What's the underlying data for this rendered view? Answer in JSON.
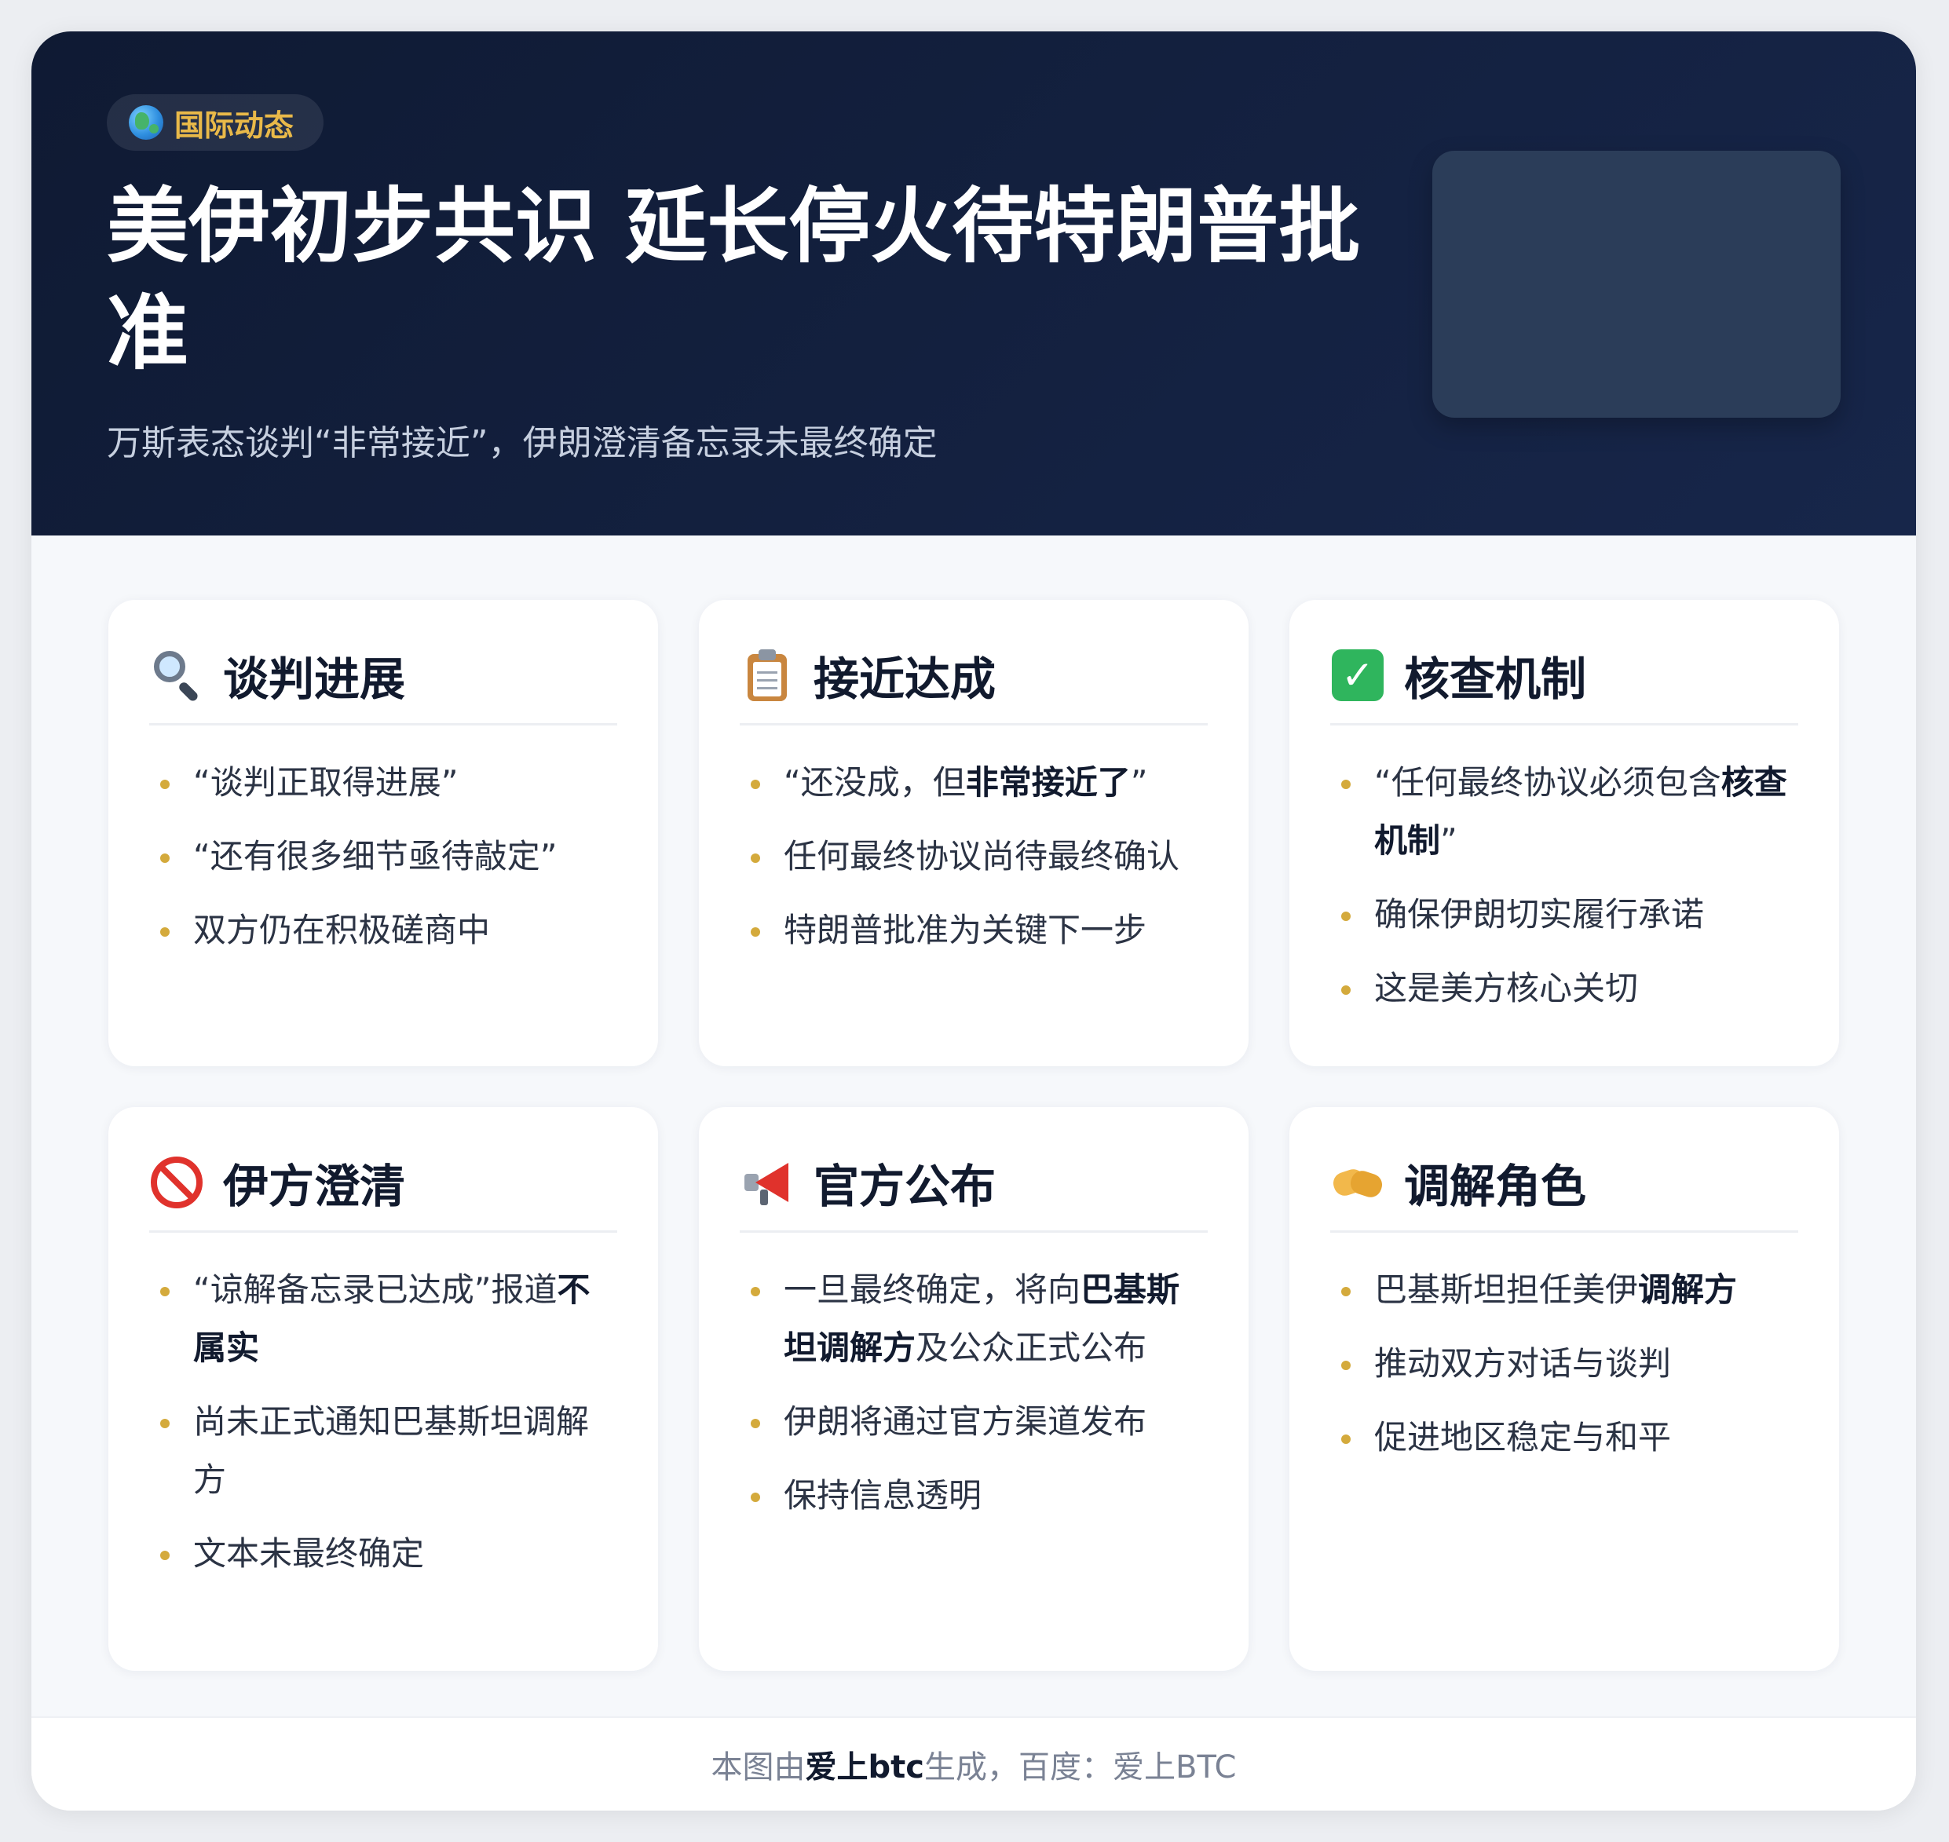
{
  "header": {
    "tag_label": "国际动态",
    "title": "美伊初步共识 延长停火待特朗普批准",
    "subtitle": "万斯表态谈判“非常接近”，伊朗澄清备忘录未最终确定"
  },
  "cards": [
    {
      "icon": "magnifier-icon",
      "title": "谈判进展",
      "items": [
        [
          {
            "t": "“谈判正取得进展”"
          }
        ],
        [
          {
            "t": "“还有很多细节亟待敲定”"
          }
        ],
        [
          {
            "t": "双方仍在积极磋商中"
          }
        ]
      ]
    },
    {
      "icon": "clipboard-icon",
      "title": "接近达成",
      "items": [
        [
          {
            "t": "“还没成，但"
          },
          {
            "t": "非常接近了",
            "b": true
          },
          {
            "t": "”"
          }
        ],
        [
          {
            "t": "任何最终协议尚待最终确认"
          }
        ],
        [
          {
            "t": "特朗普批准为关键下一步"
          }
        ]
      ]
    },
    {
      "icon": "check-icon",
      "title": "核查机制",
      "items": [
        [
          {
            "t": "“任何最终协议必须包含"
          },
          {
            "t": "核查机制",
            "b": true
          },
          {
            "t": "”"
          }
        ],
        [
          {
            "t": "确保伊朗切实履行承诺"
          }
        ],
        [
          {
            "t": "这是美方核心关切"
          }
        ]
      ]
    },
    {
      "icon": "no-entry-icon",
      "title": "伊方澄清",
      "items": [
        [
          {
            "t": "“谅解备忘录已达成”报道"
          },
          {
            "t": "不属实",
            "b": true
          }
        ],
        [
          {
            "t": "尚未正式通知巴基斯坦调解方"
          }
        ],
        [
          {
            "t": "文本未最终确定"
          }
        ]
      ]
    },
    {
      "icon": "megaphone-icon",
      "title": "官方公布",
      "items": [
        [
          {
            "t": "一旦最终确定，将向"
          },
          {
            "t": "巴基斯坦调解方",
            "b": true
          },
          {
            "t": "及公众正式公布"
          }
        ],
        [
          {
            "t": "伊朗将通过官方渠道发布"
          }
        ],
        [
          {
            "t": "保持信息透明"
          }
        ]
      ]
    },
    {
      "icon": "handshake-icon",
      "title": "调解角色",
      "items": [
        [
          {
            "t": "巴基斯坦担任美伊"
          },
          {
            "t": "调解方",
            "b": true
          }
        ],
        [
          {
            "t": "推动双方对话与谈判"
          }
        ],
        [
          {
            "t": "促进地区稳定与和平"
          }
        ]
      ]
    }
  ],
  "footer": [
    {
      "t": "本图由"
    },
    {
      "t": "爱上btc",
      "b": true
    },
    {
      "t": "生成，百度：爱上BTC"
    }
  ]
}
